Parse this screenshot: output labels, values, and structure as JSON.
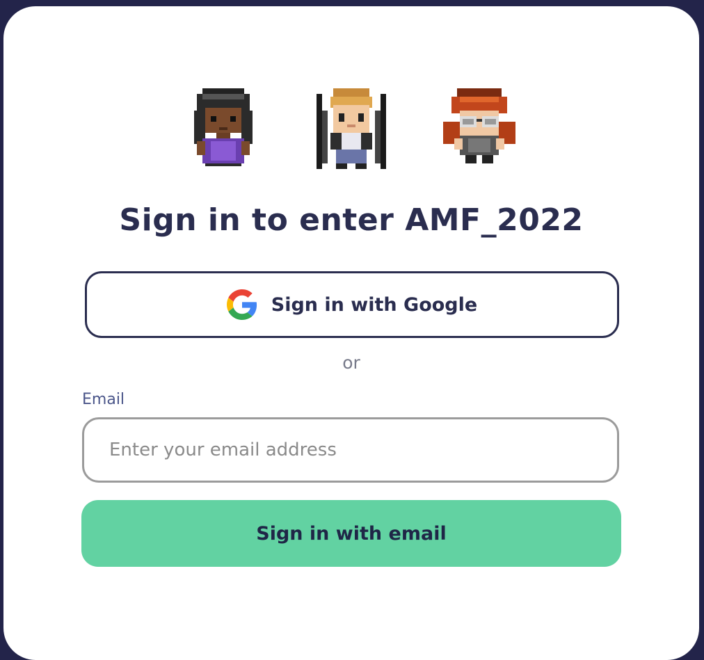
{
  "colors": {
    "page_background": "#23244a",
    "card_background": "#ffffff",
    "title_text": "#2a2d4f",
    "primary_button": "#62d2a2",
    "label_text": "#4a5589",
    "muted_text": "#777a8a"
  },
  "avatars": [
    "purple-dress-avatar",
    "blonde-wheelchair-avatar",
    "redhead-glasses-avatar"
  ],
  "title": "Sign in to enter AMF_2022",
  "google_button": {
    "label": "Sign in with Google",
    "icon": "google-logo-icon"
  },
  "separator": "or",
  "email": {
    "label": "Email",
    "value": "",
    "placeholder": "Enter your email address"
  },
  "email_button": {
    "label": "Sign in with email"
  }
}
